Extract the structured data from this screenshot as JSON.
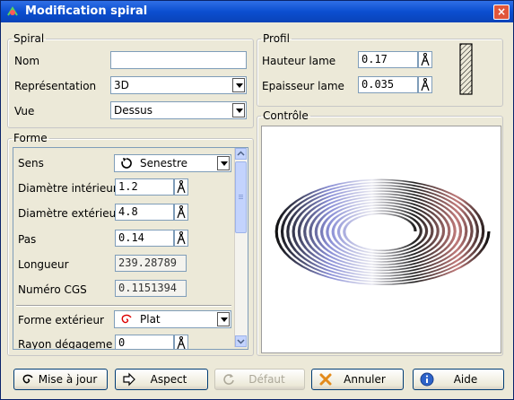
{
  "window": {
    "title": "Modification spiral"
  },
  "spiral": {
    "legend": "Spiral",
    "nom_label": "Nom",
    "nom_value": "",
    "representation_label": "Représentation",
    "representation_value": "3D",
    "vue_label": "Vue",
    "vue_value": "Dessus"
  },
  "profil": {
    "legend": "Profil",
    "hauteur_label": "Hauteur lame",
    "hauteur_value": "0.17",
    "epaisseur_label": "Epaisseur lame",
    "epaisseur_value": "0.035"
  },
  "forme": {
    "legend": "Forme",
    "sens_label": "Sens",
    "sens_value": "Senestre",
    "diam_int_label": "Diamètre intérieur",
    "diam_int_value": "1.2",
    "diam_ext_label": "Diamètre extérieur",
    "diam_ext_value": "4.8",
    "pas_label": "Pas",
    "pas_value": "0.14",
    "longueur_label": "Longueur",
    "longueur_value": "239.28789",
    "cgs_label": "Numéro CGS",
    "cgs_value": "0.1151394",
    "forme_ext_label": "Forme extérieur",
    "forme_ext_value": "Plat",
    "rayon_label": "Rayon dégageme",
    "rayon_value": "0"
  },
  "controle": {
    "legend": "Contrôle"
  },
  "buttons": {
    "maj": "Mise à jour",
    "aspect": "Aspect",
    "defaut": "Défaut",
    "annuler": "Annuler",
    "aide": "Aide"
  }
}
